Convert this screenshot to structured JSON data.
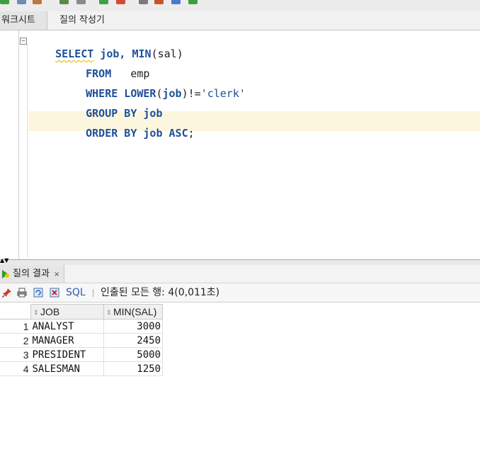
{
  "editor_tabs": {
    "worksheet": "워크시트",
    "query_builder": "질의 작성기"
  },
  "code": {
    "line1": {
      "kw1": "SELECT",
      "ident": " job, ",
      "kw2": "MIN",
      "rest": "(sal)"
    },
    "line2": {
      "kw": "FROM",
      "rest": "   emp"
    },
    "line3": {
      "kw1": "WHERE",
      "kw2": " LOWER",
      "p1": "(",
      "kw3": "job",
      "p2": ")!=",
      "str": "'clerk'"
    },
    "line4": {
      "kw": "GROUP BY job"
    },
    "line5": {
      "kw": "ORDER BY job ASC",
      "rest": ";"
    }
  },
  "results": {
    "tab_label": "질의 결과",
    "tab_close": "×",
    "sql_label": "SQL",
    "status": "인출된 모든 행: 4(0,011초)",
    "columns": [
      "JOB",
      "MIN(SAL)"
    ],
    "rows": [
      {
        "n": "1",
        "job": "ANALYST",
        "min_sal": "3000"
      },
      {
        "n": "2",
        "job": "MANAGER",
        "min_sal": "2450"
      },
      {
        "n": "3",
        "job": "PRESIDENT",
        "min_sal": "5000"
      },
      {
        "n": "4",
        "job": "SALESMAN",
        "min_sal": "1250"
      }
    ]
  },
  "colors": {
    "keyword": "#1f4f9a",
    "current_line": "#fdf6df",
    "accent": "#2a5db0"
  }
}
